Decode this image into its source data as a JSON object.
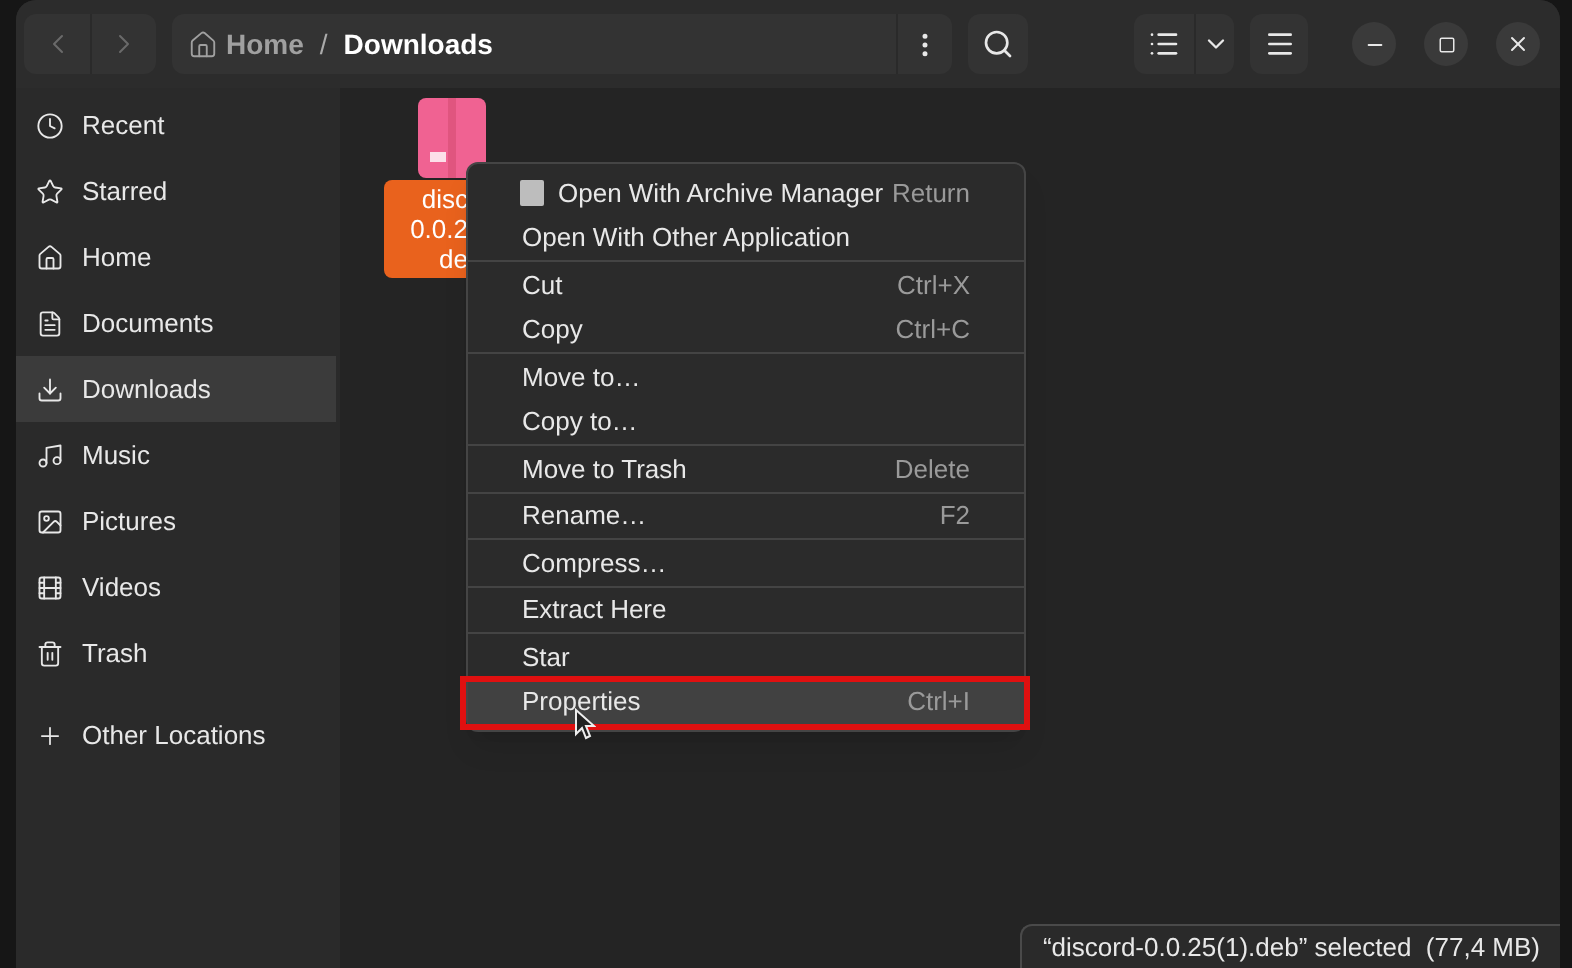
{
  "header": {
    "nav_buttons": [
      {
        "kind": "back",
        "disabled": true
      },
      {
        "kind": "forward",
        "disabled": true
      }
    ],
    "path_separator": "/",
    "path": [
      {
        "label": "Home",
        "kind": "home",
        "current": false
      },
      {
        "label": "Downloads",
        "kind": "folder",
        "current": true
      }
    ]
  },
  "sidebar": {
    "items": [
      {
        "label": "Recent",
        "kind": "recent",
        "selected": false
      },
      {
        "label": "Starred",
        "kind": "starred",
        "selected": false
      },
      {
        "label": "Home",
        "kind": "home",
        "selected": false
      },
      {
        "label": "Documents",
        "kind": "documents",
        "selected": false
      },
      {
        "label": "Downloads",
        "kind": "downloads",
        "selected": true
      },
      {
        "label": "Music",
        "kind": "music",
        "selected": false
      },
      {
        "label": "Pictures",
        "kind": "pictures",
        "selected": false
      },
      {
        "label": "Videos",
        "kind": "videos",
        "selected": false
      },
      {
        "label": "Trash",
        "kind": "trash",
        "selected": false
      }
    ],
    "other_locations": "Other Locations"
  },
  "files": [
    {
      "name_lines": [
        "disc",
        "0.0.2",
        "de"
      ],
      "selected": true
    }
  ],
  "context_menu": {
    "groups": [
      [
        {
          "label": "Open With Archive Manager",
          "shortcut": "Return",
          "has_icon": true,
          "highlighted": false,
          "annotated": false
        },
        {
          "label": "Open With Other Application",
          "has_icon": false,
          "highlighted": false,
          "annotated": false
        }
      ],
      [
        {
          "label": "Cut",
          "shortcut": "Ctrl+X",
          "has_icon": false,
          "highlighted": false,
          "annotated": false
        },
        {
          "label": "Copy",
          "shortcut": "Ctrl+C",
          "has_icon": false,
          "highlighted": false,
          "annotated": false
        }
      ],
      [
        {
          "label": "Move to…",
          "has_icon": false,
          "highlighted": false,
          "annotated": false
        },
        {
          "label": "Copy to…",
          "has_icon": false,
          "highlighted": false,
          "annotated": false
        }
      ],
      [
        {
          "label": "Move to Trash",
          "shortcut": "Delete",
          "has_icon": false,
          "highlighted": false,
          "annotated": false
        }
      ],
      [
        {
          "label": "Rename…",
          "shortcut": "F2",
          "has_icon": false,
          "highlighted": false,
          "annotated": false
        }
      ],
      [
        {
          "label": "Compress…",
          "has_icon": false,
          "highlighted": false,
          "annotated": false
        }
      ],
      [
        {
          "label": "Extract Here",
          "has_icon": false,
          "highlighted": false,
          "annotated": false
        }
      ],
      [
        {
          "label": "Star",
          "has_icon": false,
          "highlighted": false,
          "annotated": false
        },
        {
          "label": "Properties",
          "shortcut": "Ctrl+I",
          "has_icon": false,
          "highlighted": true,
          "annotated": true
        }
      ]
    ]
  },
  "status_bar": "“discord-0.0.25(1).deb” selected  (77,4 MB)"
}
